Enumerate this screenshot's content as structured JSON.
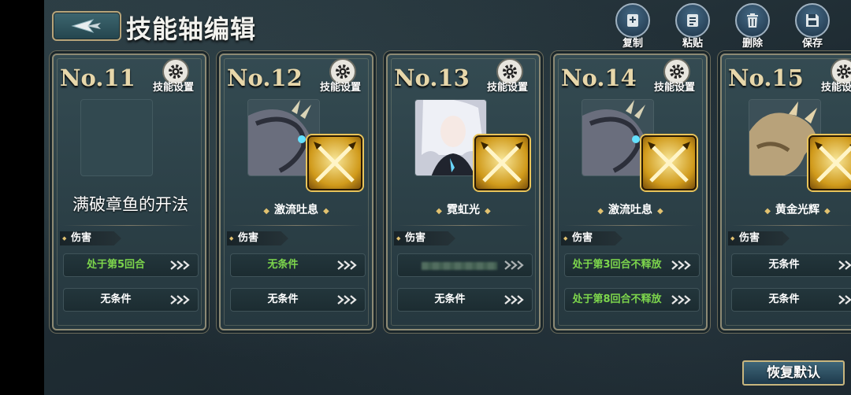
{
  "header": {
    "title": "技能轴编辑",
    "tools": [
      {
        "label": "复制",
        "icon": "copy-icon"
      },
      {
        "label": "粘贴",
        "icon": "paste-icon"
      },
      {
        "label": "删除",
        "icon": "trash-icon"
      },
      {
        "label": "保存",
        "icon": "save-icon"
      }
    ]
  },
  "cards": [
    {
      "no": "No.11",
      "settings_label": "技能设置",
      "name": "满破章鱼的开法",
      "type": "伤害",
      "conditions": [
        "处于第5回合",
        "无条件"
      ]
    },
    {
      "no": "No.12",
      "settings_label": "技能设置",
      "name": "激流吐息",
      "type": "伤害",
      "conditions": [
        "无条件",
        "无条件"
      ]
    },
    {
      "no": "No.13",
      "settings_label": "技能设置",
      "name": "霓虹光",
      "type": "伤害",
      "conditions": [
        "",
        "无条件"
      ]
    },
    {
      "no": "No.14",
      "settings_label": "技能设置",
      "name": "激流吐息",
      "type": "伤害",
      "conditions": [
        "处于第3回合不释放",
        "处于第8回合不释放"
      ]
    },
    {
      "no": "No.15",
      "settings_label": "技能设置",
      "name": "黄金光辉",
      "type": "伤害",
      "conditions": [
        "无条件",
        "无条件"
      ]
    }
  ],
  "footer": {
    "restore_label": "恢复默认"
  },
  "colors": {
    "condition_active": "#7dd64c",
    "gold": "#e7d7aa"
  }
}
